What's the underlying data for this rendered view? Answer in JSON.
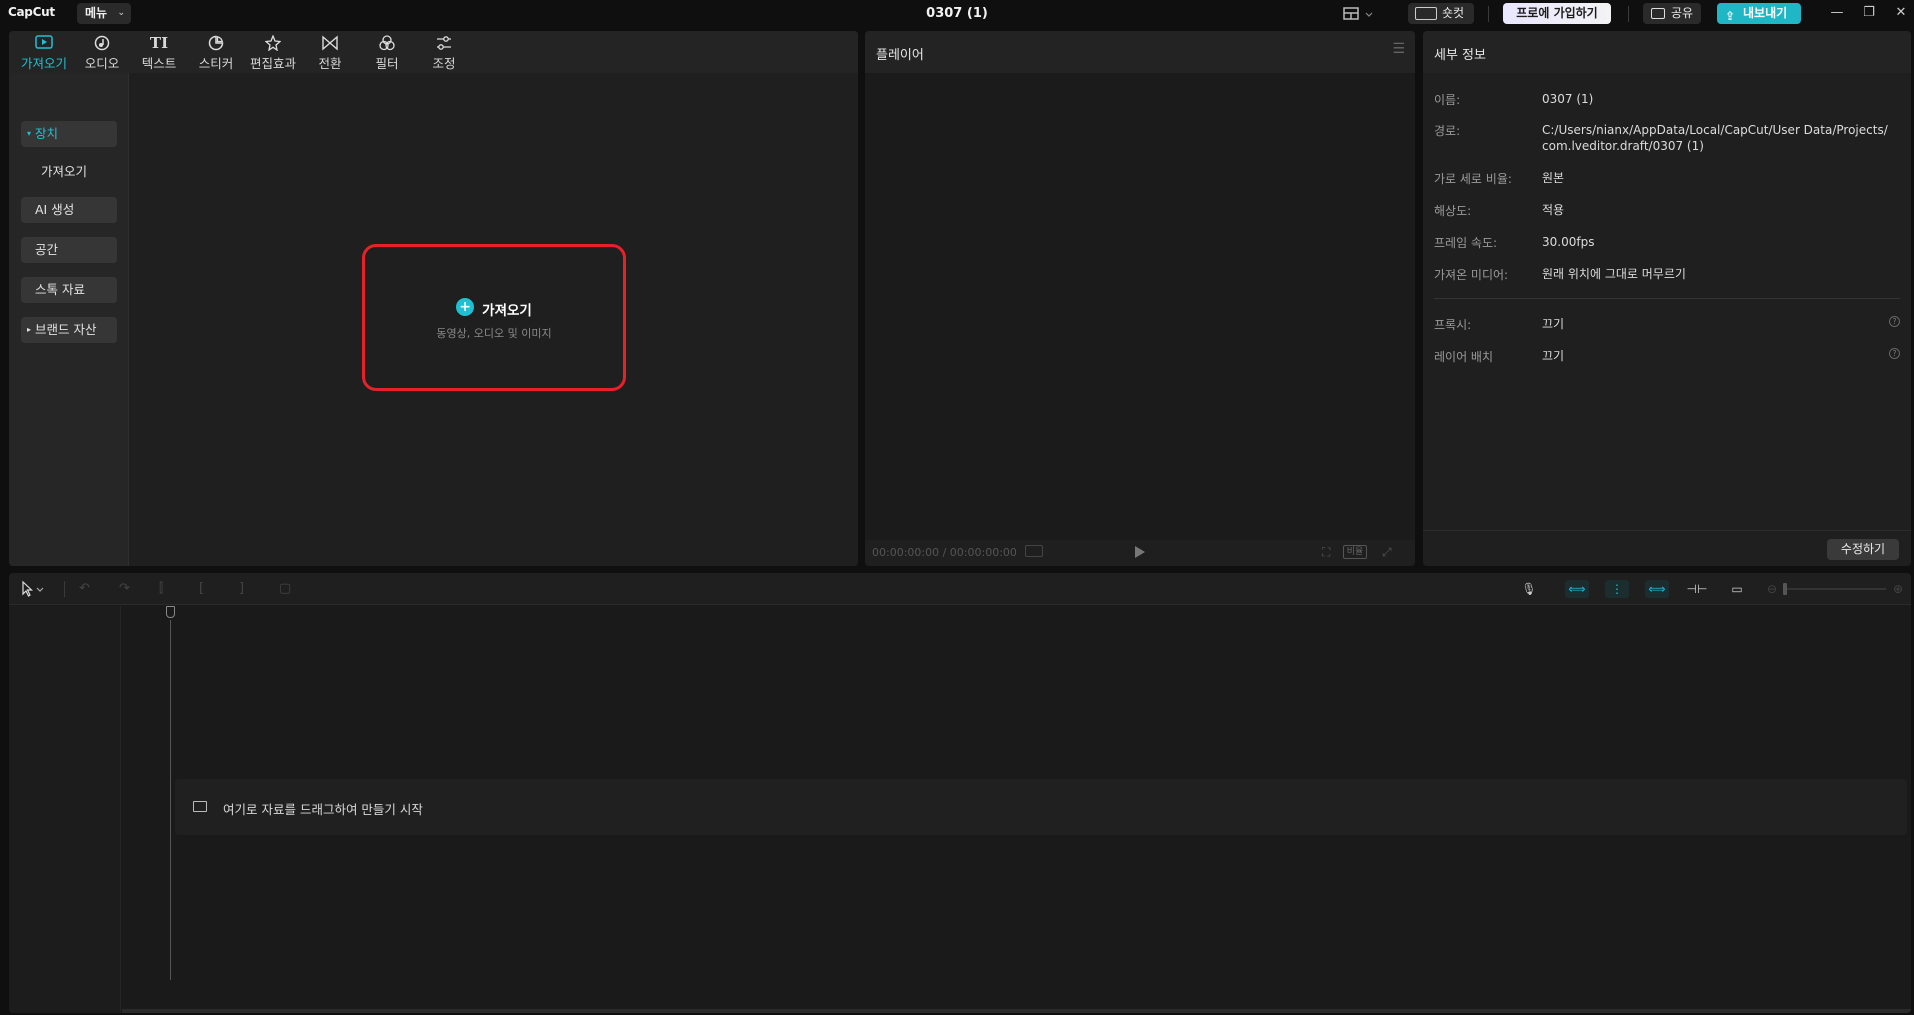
{
  "app": {
    "logo": "CapCut",
    "menu_label": "메뉴",
    "document_title": "0307 (1)",
    "shortcut_label": "숏컷",
    "pro_label": "프로에 가입하기",
    "share_label": "공유",
    "export_label": "내보내기",
    "accent_color": "#1fc1d1"
  },
  "media": {
    "tabs": [
      {
        "label": "가져오기",
        "icon": "import-icon",
        "active": true
      },
      {
        "label": "오디오",
        "icon": "audio-icon"
      },
      {
        "label": "텍스트",
        "icon": "text-icon"
      },
      {
        "label": "스티커",
        "icon": "sticker-icon"
      },
      {
        "label": "편집효과",
        "icon": "effects-icon"
      },
      {
        "label": "전환",
        "icon": "transition-icon"
      },
      {
        "label": "필터",
        "icon": "filter-icon"
      },
      {
        "label": "조정",
        "icon": "adjust-icon"
      }
    ],
    "sidebar": [
      {
        "label": "장치",
        "selected": true
      },
      {
        "label": "가져오기"
      },
      {
        "label": "AI 생성"
      },
      {
        "label": "공간"
      },
      {
        "label": "스톡 자료"
      },
      {
        "label": "브랜드 자산"
      }
    ],
    "import_title": "가져오기",
    "import_subtitle": "동영상, 오디오 및 이미지"
  },
  "player": {
    "title": "플레이어",
    "timecode": "00:00:00:00 / 00:00:00:00",
    "ratio_label": "비율"
  },
  "details": {
    "title": "세부 정보",
    "rows": [
      {
        "label": "이름:",
        "value": "0307 (1)"
      },
      {
        "label": "경로:",
        "value": "C:/Users/nianx/AppData/Local/CapCut/User Data/Projects/com.lveditor.draft/0307 (1)"
      },
      {
        "label": "가로 세로 비율:",
        "value": "원본"
      },
      {
        "label": "해상도:",
        "value": "적용"
      },
      {
        "label": "프레임 속도:",
        "value": "30.00fps"
      },
      {
        "label": "가져온 미디어:",
        "value": "원래 위치에 그대로 머무르기"
      },
      {
        "label": "프록시:",
        "value": "끄기"
      },
      {
        "label": "레이어 배치",
        "value": "끄기"
      }
    ],
    "edit_label": "수정하기"
  },
  "timeline": {
    "drop_hint": "여기로 자료를 드래그하여 만들기 시작"
  }
}
